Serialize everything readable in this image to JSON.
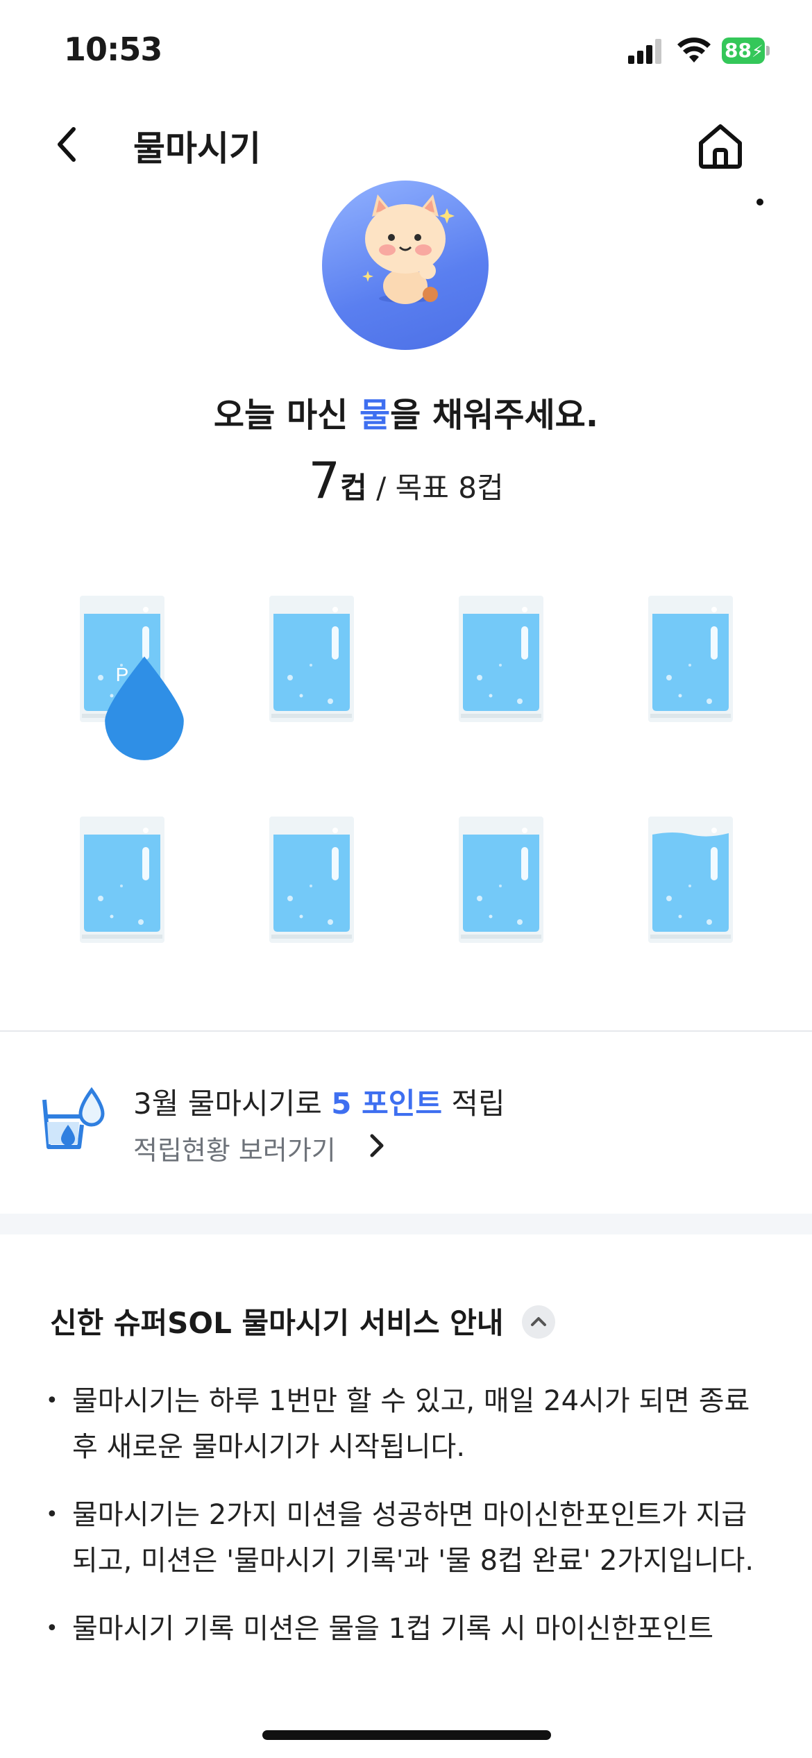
{
  "status_bar": {
    "time": "10:53",
    "battery": "88"
  },
  "header": {
    "title": "물마시기"
  },
  "summary": {
    "headline_pre": "오늘 마신 ",
    "headline_accent": "물",
    "headline_post": "을 채워주세요.",
    "cups": "7",
    "cups_unit": "컵",
    "goal": " / 목표 8컵"
  },
  "glasses": {
    "first_badge": "P",
    "levels": [
      1,
      1,
      1,
      1,
      1,
      1,
      1,
      1
    ]
  },
  "points": {
    "line_pre": "3월 물마시기로 ",
    "line_accent": "5 포인트",
    "line_post": " 적립",
    "link": "적립현황 보러가기"
  },
  "info": {
    "title": "신한 슈퍼SOL 물마시기 서비스 안내",
    "bullets": [
      "물마시기는 하루 1번만 할 수 있고, 매일 24시가 되면 종료 후 새로운 물마시기가 시작됩니다.",
      "물마시기는 2가지 미션을 성공하면 마이신한포인트가 지급되고, 미션은 '물마시기 기록'과 '물 8컵 완료' 2가지입니다.",
      "물마시기 기록 미션은 물을 1컵 기록 시 마이신한포인트"
    ]
  },
  "colors": {
    "accent": "#3e6ff0",
    "water": "#74c9f8",
    "battery": "#34c759"
  }
}
